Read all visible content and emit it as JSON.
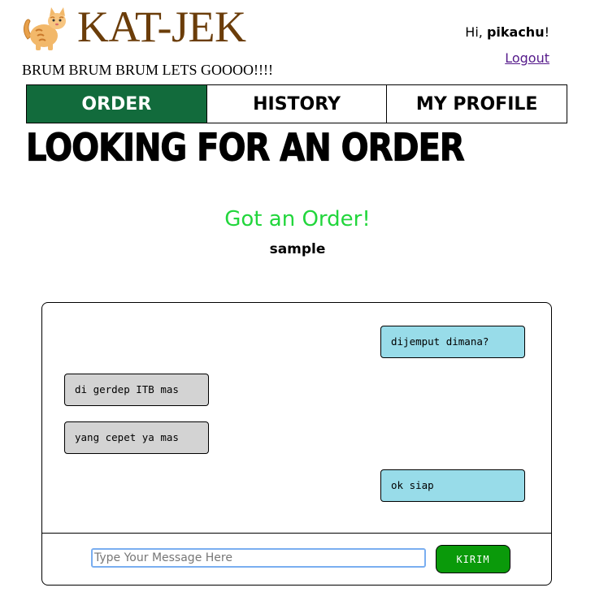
{
  "header": {
    "logo_icon": "cat-emoji-icon",
    "brand": "KAT-JEK",
    "tagline": "BRUM BRUM BRUM LETS GOOOO!!!!",
    "greeting_prefix": "Hi, ",
    "username": "pikachu",
    "greeting_suffix": "!",
    "logout_label": "Logout"
  },
  "nav": {
    "tabs": [
      {
        "label": "ORDER",
        "active": true
      },
      {
        "label": "HISTORY",
        "active": false
      },
      {
        "label": "MY PROFILE",
        "active": false
      }
    ],
    "active_color": "#126b3c"
  },
  "main": {
    "page_title": "LOOKING FOR AN ORDER",
    "status": "Got an Order!",
    "status_color": "#22d63c",
    "passenger_name": "sample"
  },
  "chat": {
    "messages": [
      {
        "text": "dijemput dimana?",
        "from": "me"
      },
      {
        "text": "di gerdep ITB mas",
        "from": "customer"
      },
      {
        "text": "yang cepet ya mas",
        "from": "customer"
      },
      {
        "text": "ok siap",
        "from": "me"
      }
    ],
    "input_value": "",
    "input_placeholder": "Type Your Message Here",
    "send_label": "KIRIM",
    "my_bubble_color": "#98dce9",
    "their_bubble_color": "#d3d3d3",
    "send_color": "#0a9a0a"
  }
}
